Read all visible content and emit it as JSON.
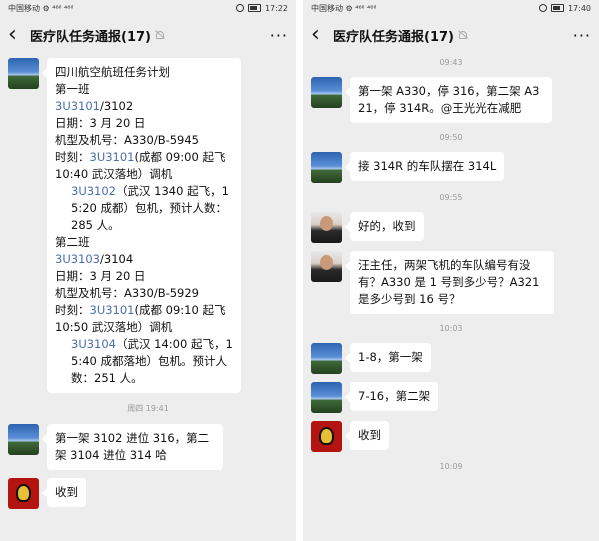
{
  "left": {
    "status": {
      "carrier": "中国移动 ⚙ ⁴⁶ᴵˡ ⁴⁶ᴵˡ",
      "time": "17:22"
    },
    "header": {
      "title": "医疗队任务通报(17)"
    },
    "plan": {
      "title": "四川航空航班任务计划",
      "shift1_label": "第一班",
      "shift1_flight_a": "3U3101",
      "shift1_flight_b": "/3102",
      "shift1_date": "日期：3 月 20 日",
      "shift1_aircraft": "机型及机号：A330/B-5945",
      "shift1_time_prefix": "时刻：",
      "shift1_time_flight": "3U3101",
      "shift1_time_text": "(成都 09:00 起飞 10:40 武汉落地）调机",
      "shift1_return_flight": "3U3102",
      "shift1_return_text": "（武汉 1340 起飞，15:20 成都）包机，预计人数：285 人。",
      "shift2_label": "第二班",
      "shift2_flight_a": "3U3103",
      "shift2_flight_b": "/3104",
      "shift2_date": "日期：3 月 20 日",
      "shift2_aircraft": "机型及机号：A330/B-5929",
      "shift2_time_prefix": "时刻：",
      "shift2_time_flight": "3U3101",
      "shift2_time_text": "(成都 09:10 起飞 10:50 武汉落地）调机",
      "shift2_return_flight": "3U3104",
      "shift2_return_text": "（武汉 14:00 起飞，15:40 成都落地）包机。预计人数：251 人。"
    },
    "ts1": "周四 19:41",
    "msg2": "第一架 3102 进位 316，第二架 3104 进位 314 哈",
    "msg3": "收到"
  },
  "right": {
    "status": {
      "carrier": "中国移动 ⚙ ⁴⁶ᴵˡ ⁴⁶ᴵˡ",
      "time": "17:40"
    },
    "header": {
      "title": "医疗队任务通报(17)"
    },
    "ts1": "09:43",
    "msg1": "第一架 A330，停 316，第二架 A321，停 314R。@王光光在减肥",
    "ts2": "09:50",
    "msg2": "接 314R 的车队摆在 314L",
    "ts3": "09:55",
    "msg3": "好的，收到",
    "msg4": "汪主任，两架飞机的车队编号有没有？A330 是 1 号到多少号？A321 是多少号到 16 号？",
    "ts4": "10:03",
    "msg5": "1-8，第一架",
    "msg6": "7-16，第二架",
    "msg7": "收到",
    "ts5": "10:09"
  }
}
